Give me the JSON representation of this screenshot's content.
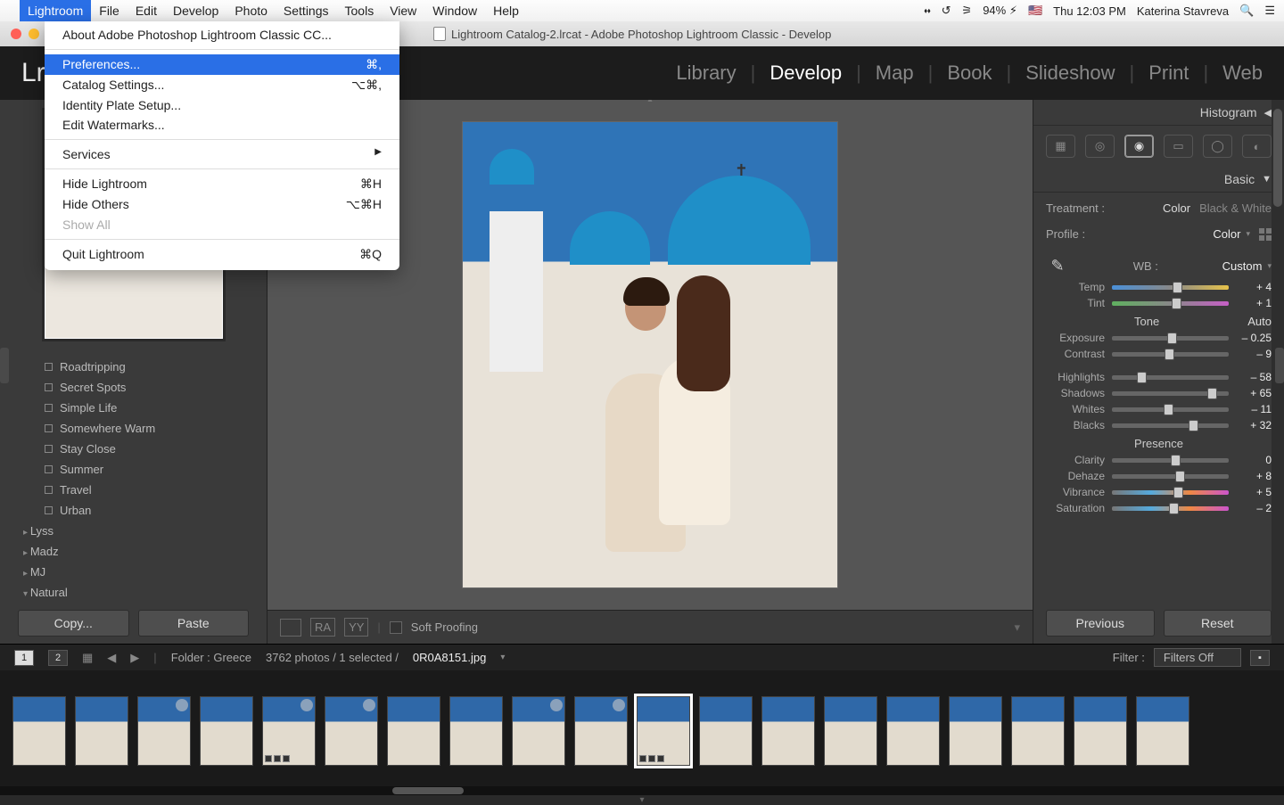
{
  "menubar": {
    "app": "Lightroom",
    "items": [
      "File",
      "Edit",
      "Develop",
      "Photo",
      "Settings",
      "Tools",
      "View",
      "Window",
      "Help"
    ],
    "battery": "94%",
    "clock": "Thu 12:03 PM",
    "user": "Katerina Stavreva"
  },
  "dropdown": {
    "about": "About Adobe Photoshop Lightroom Classic CC...",
    "preferences": "Preferences...",
    "preferences_sc": "⌘,",
    "catalog": "Catalog Settings...",
    "catalog_sc": "⌥⌘,",
    "identity": "Identity Plate Setup...",
    "watermarks": "Edit Watermarks...",
    "services": "Services",
    "hide": "Hide Lightroom",
    "hide_sc": "⌘H",
    "hideothers": "Hide Others",
    "hideothers_sc": "⌥⌘H",
    "showall": "Show All",
    "quit": "Quit Lightroom",
    "quit_sc": "⌘Q"
  },
  "titlebar": {
    "doc": "Lightroom Catalog-2.lrcat - Adobe Photoshop Lightroom Classic - Develop"
  },
  "modules": {
    "logo": "Lr",
    "items": [
      "Library",
      "Develop",
      "Map",
      "Book",
      "Slideshow",
      "Print",
      "Web"
    ],
    "active": "Develop"
  },
  "folders": {
    "items": [
      "Roadtripping",
      "Secret Spots",
      "Simple Life",
      "Somewhere Warm",
      "Stay Close",
      "Summer",
      "Travel",
      "Urban"
    ],
    "parents": [
      "Lyss",
      "Madz",
      "MJ",
      "Natural"
    ]
  },
  "leftButtons": {
    "copy": "Copy...",
    "paste": "Paste"
  },
  "toolbar": {
    "soft": "Soft Proofing",
    "ra": "RA",
    "yy": "YY"
  },
  "right": {
    "histogram": "Histogram",
    "basic": "Basic",
    "treatment": "Treatment :",
    "color": "Color",
    "bw": "Black & White",
    "profile": "Profile :",
    "profile_v": "Color",
    "wb": "WB :",
    "wb_v": "Custom",
    "tone": "Tone",
    "auto": "Auto",
    "presence": "Presence",
    "sliders": {
      "temp": {
        "label": "Temp",
        "value": "+ 4",
        "pos": 52
      },
      "tint": {
        "label": "Tint",
        "value": "+ 1",
        "pos": 51
      },
      "exposure": {
        "label": "Exposure",
        "value": "– 0.25",
        "pos": 47
      },
      "contrast": {
        "label": "Contrast",
        "value": "– 9",
        "pos": 45
      },
      "highlights": {
        "label": "Highlights",
        "value": "– 58",
        "pos": 21
      },
      "shadows": {
        "label": "Shadows",
        "value": "+ 65",
        "pos": 82
      },
      "whites": {
        "label": "Whites",
        "value": "– 11",
        "pos": 44
      },
      "blacks": {
        "label": "Blacks",
        "value": "+ 32",
        "pos": 66
      },
      "clarity": {
        "label": "Clarity",
        "value": "0",
        "pos": 50
      },
      "dehaze": {
        "label": "Dehaze",
        "value": "+ 8",
        "pos": 54
      },
      "vibrance": {
        "label": "Vibrance",
        "value": "+ 5",
        "pos": 53
      },
      "saturation": {
        "label": "Saturation",
        "value": "– 2",
        "pos": 49
      }
    },
    "previous": "Previous",
    "reset": "Reset"
  },
  "info": {
    "folder": "Folder : Greece",
    "count": "3762 photos / 1 selected /",
    "filename": "0R0A8151.jpg",
    "filter": "Filter :",
    "filter_v": "Filters Off"
  }
}
